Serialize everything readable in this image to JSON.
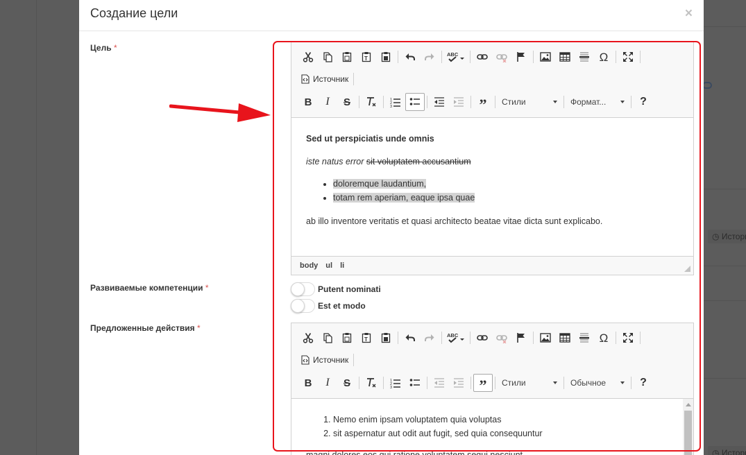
{
  "modal": {
    "title": "Создание цели",
    "close": "×"
  },
  "fields": {
    "goal_label": "Цель",
    "competencies_label": "Развиваемые компетенции",
    "actions_label": "Предложенные действия",
    "required_mark": "*"
  },
  "editor1": {
    "source_label": "Источник",
    "styles_combo": "Стили",
    "format_combo": "Формат...",
    "help": "?",
    "heading": "Sed ut perspiciatis unde omnis",
    "italic_text": "iste natus error ",
    "strike_text": "sit voluptatem accusantium",
    "bullets": [
      "doloremque laudantium, ",
      "totam rem aperiam, eaque ipsa quae"
    ],
    "paragraph": "ab illo inventore veritatis et quasi architecto beatae vitae dicta sunt explicabo.",
    "path": [
      "body",
      "ul",
      "li"
    ]
  },
  "competencies": [
    {
      "label": "Putent nominati",
      "on": false
    },
    {
      "label": "Est et modo",
      "on": false
    }
  ],
  "editor2": {
    "source_label": "Источник",
    "styles_combo": "Стили",
    "format_combo": "Обычное",
    "help": "?",
    "numbered": [
      "Nemo enim ipsam voluptatem quia voluptas",
      "sit aspernatur aut odit aut fugit, sed quia consequuntur"
    ],
    "cut_paragraph": "magni dolores eos qui ratione voluptatem sequi nesciunt"
  },
  "background": {
    "history_label": "Истори"
  },
  "colors": {
    "highlight": "#e8141c",
    "required": "#d9534f",
    "overlay": "#5c5c5c"
  }
}
